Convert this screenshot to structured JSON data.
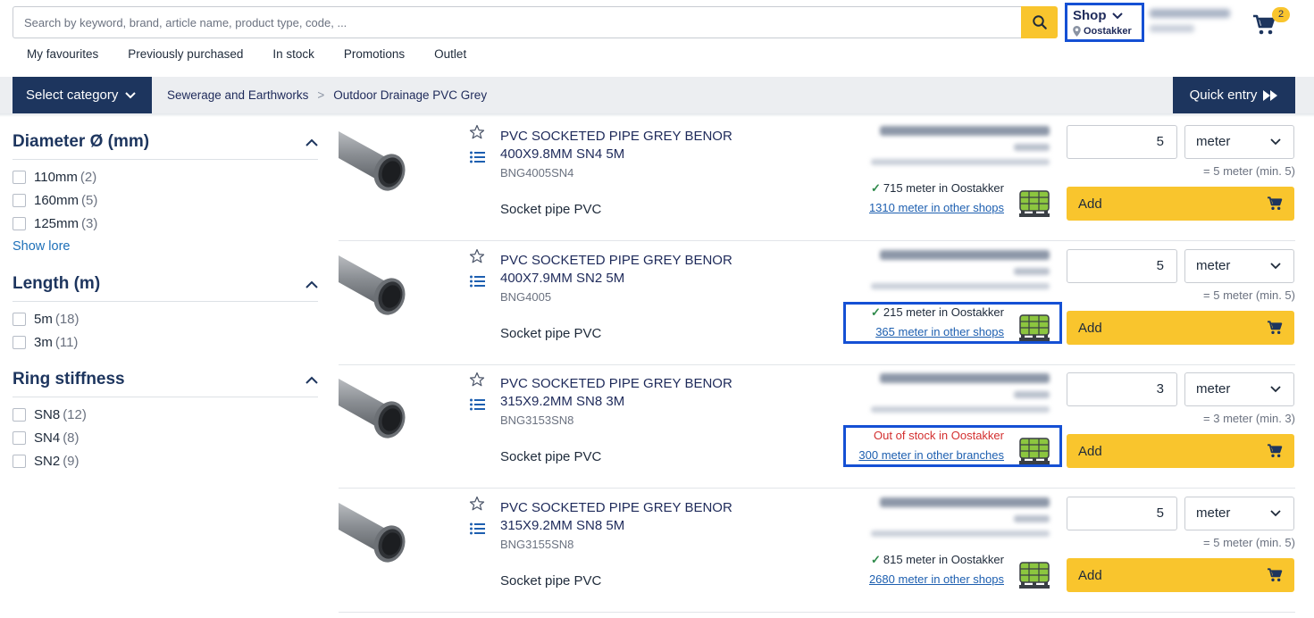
{
  "header": {
    "search_placeholder": "Search by keyword, brand, article name, product type, code, ...",
    "shop_label": "Shop",
    "shop_location": "Oostakker",
    "cart_count": "2"
  },
  "quicklinks": [
    "My favourites",
    "Previously purchased",
    "In stock",
    "Promotions",
    "Outlet"
  ],
  "catbar": {
    "select_category": "Select category",
    "breadcrumb": [
      "Sewerage and Earthworks",
      "Outdoor Drainage PVC Grey"
    ],
    "breadcrumb_sep": ">",
    "quick_entry": "Quick entry"
  },
  "filters": [
    {
      "title": "Diameter Ø (mm)",
      "options": [
        {
          "label": "110mm",
          "count": "(2)"
        },
        {
          "label": "160mm",
          "count": "(5)"
        },
        {
          "label": "125mm",
          "count": "(3)"
        }
      ],
      "show_more": "Show lore"
    },
    {
      "title": "Length (m)",
      "options": [
        {
          "label": "5m",
          "count": "(18)"
        },
        {
          "label": "3m",
          "count": "(11)"
        }
      ]
    },
    {
      "title": "Ring stiffness",
      "options": [
        {
          "label": "SN8",
          "count": "(12)"
        },
        {
          "label": "SN4",
          "count": "(8)"
        },
        {
          "label": "SN2",
          "count": "(9)"
        }
      ]
    }
  ],
  "products": [
    {
      "title": "PVC SOCKETED PIPE GREY BENOR 400X9.8MM SN4 5M",
      "code": "BNG4005SN4",
      "type": "Socket pipe PVC",
      "stock_local": "715 meter in Oostakker",
      "stock_local_status": "in",
      "stock_other": "1310 meter in other shops",
      "qty": "5",
      "unit": "meter",
      "min_note": "= 5 meter (min. 5)",
      "add_label": "Add",
      "highlighted": false
    },
    {
      "title": "PVC SOCKETED PIPE GREY BENOR 400X7.9MM SN2 5M",
      "code": "BNG4005",
      "type": "Socket pipe PVC",
      "stock_local": "215 meter in Oostakker",
      "stock_local_status": "in",
      "stock_other": "365 meter in other shops",
      "qty": "5",
      "unit": "meter",
      "min_note": "= 5 meter (min. 5)",
      "add_label": "Add",
      "highlighted": true
    },
    {
      "title": "PVC SOCKETED PIPE GREY BENOR 315X9.2MM SN8 3M",
      "code": "BNG3153SN8",
      "type": "Socket pipe PVC",
      "stock_local": "Out of stock in Oostakker",
      "stock_local_status": "out",
      "stock_other": "300 meter in other branches",
      "qty": "3",
      "unit": "meter",
      "min_note": "= 3 meter (min. 3)",
      "add_label": "Add",
      "highlighted": true
    },
    {
      "title": "PVC SOCKETED PIPE GREY BENOR 315X9.2MM SN8 5M",
      "code": "BNG3155SN8",
      "type": "Socket pipe PVC",
      "stock_local": "815 meter in Oostakker",
      "stock_local_status": "in",
      "stock_other": "2680 meter in other shops",
      "qty": "5",
      "unit": "meter",
      "min_note": "= 5 meter (min. 5)",
      "add_label": "Add",
      "highlighted": false
    }
  ],
  "colors": {
    "accent": "#f9c52d",
    "navy": "#1d355e",
    "highlight": "#1550d4",
    "out_of_stock": "#d32f2f",
    "link": "#1d5fb0"
  }
}
